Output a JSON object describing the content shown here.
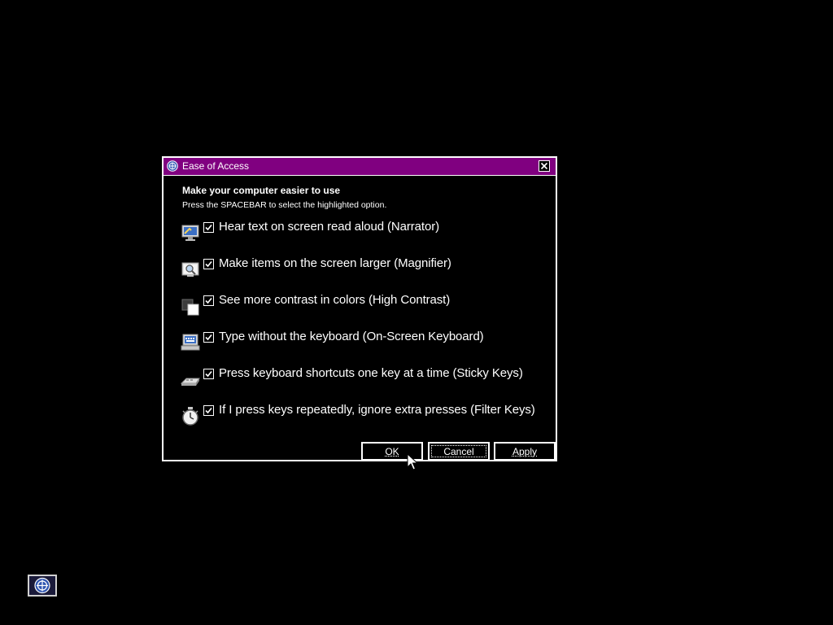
{
  "dialog": {
    "title": "Ease of Access",
    "heading": "Make your computer easier to use",
    "instruction": "Press the SPACEBAR to select the highlighted option.",
    "options": [
      {
        "label": "Hear text on screen read aloud (Narrator)",
        "checked": true,
        "icon": "narrator-icon"
      },
      {
        "label": "Make items on the screen larger (Magnifier)",
        "checked": true,
        "icon": "magnifier-icon"
      },
      {
        "label": "See more contrast in colors (High Contrast)",
        "checked": true,
        "icon": "high-contrast-icon"
      },
      {
        "label": "Type without the keyboard (On-Screen Keyboard)",
        "checked": true,
        "icon": "on-screen-keyboard-icon"
      },
      {
        "label": "Press keyboard shortcuts one key at a time (Sticky Keys)",
        "checked": true,
        "icon": "sticky-keys-icon"
      },
      {
        "label": "If I press keys repeatedly, ignore extra presses (Filter Keys)",
        "checked": true,
        "icon": "filter-keys-icon"
      }
    ],
    "buttons": {
      "ok": "OK",
      "cancel": "Cancel",
      "apply": "Apply"
    }
  },
  "colors": {
    "titlebar": "#800080",
    "background": "#000000",
    "foreground": "#ffffff"
  },
  "taskbar": {
    "icon": "ease-of-access-icon"
  }
}
